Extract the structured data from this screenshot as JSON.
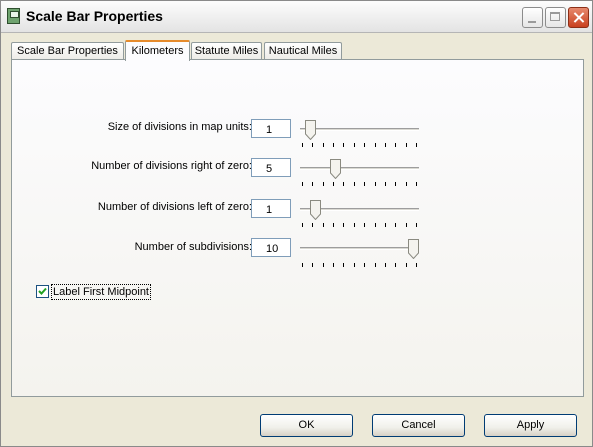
{
  "window": {
    "title": "Scale Bar Properties"
  },
  "tabs": [
    {
      "label": "Scale Bar Properties",
      "active": false
    },
    {
      "label": "Kilometers",
      "active": true
    },
    {
      "label": "Statute Miles",
      "active": false
    },
    {
      "label": "Nautical Miles",
      "active": false
    }
  ],
  "rows": [
    {
      "label": "Size of divisions in map units:",
      "value": "1",
      "slider_level": 0.05
    },
    {
      "label": "Number of divisions right of zero:",
      "value": "5",
      "slider_level": 0.28
    },
    {
      "label": "Number of divisions left of zero:",
      "value": "1",
      "slider_level": 0.09
    },
    {
      "label": "Number of subdivisions:",
      "value": "10",
      "slider_level": 1.0
    }
  ],
  "checkbox": {
    "label": "Label First Midpoint",
    "checked": true
  },
  "buttons": {
    "ok": "OK",
    "cancel": "Cancel",
    "apply": "Apply"
  },
  "icons": {
    "app": "map-window-icon",
    "minimize": "minimize-icon",
    "maximize": "maximize-icon",
    "close": "close-icon",
    "checkmark": "check-icon"
  },
  "colors": {
    "tab_accent": "#E68B2C",
    "close_button": "#C9401F",
    "input_border": "#7F9DB9"
  }
}
